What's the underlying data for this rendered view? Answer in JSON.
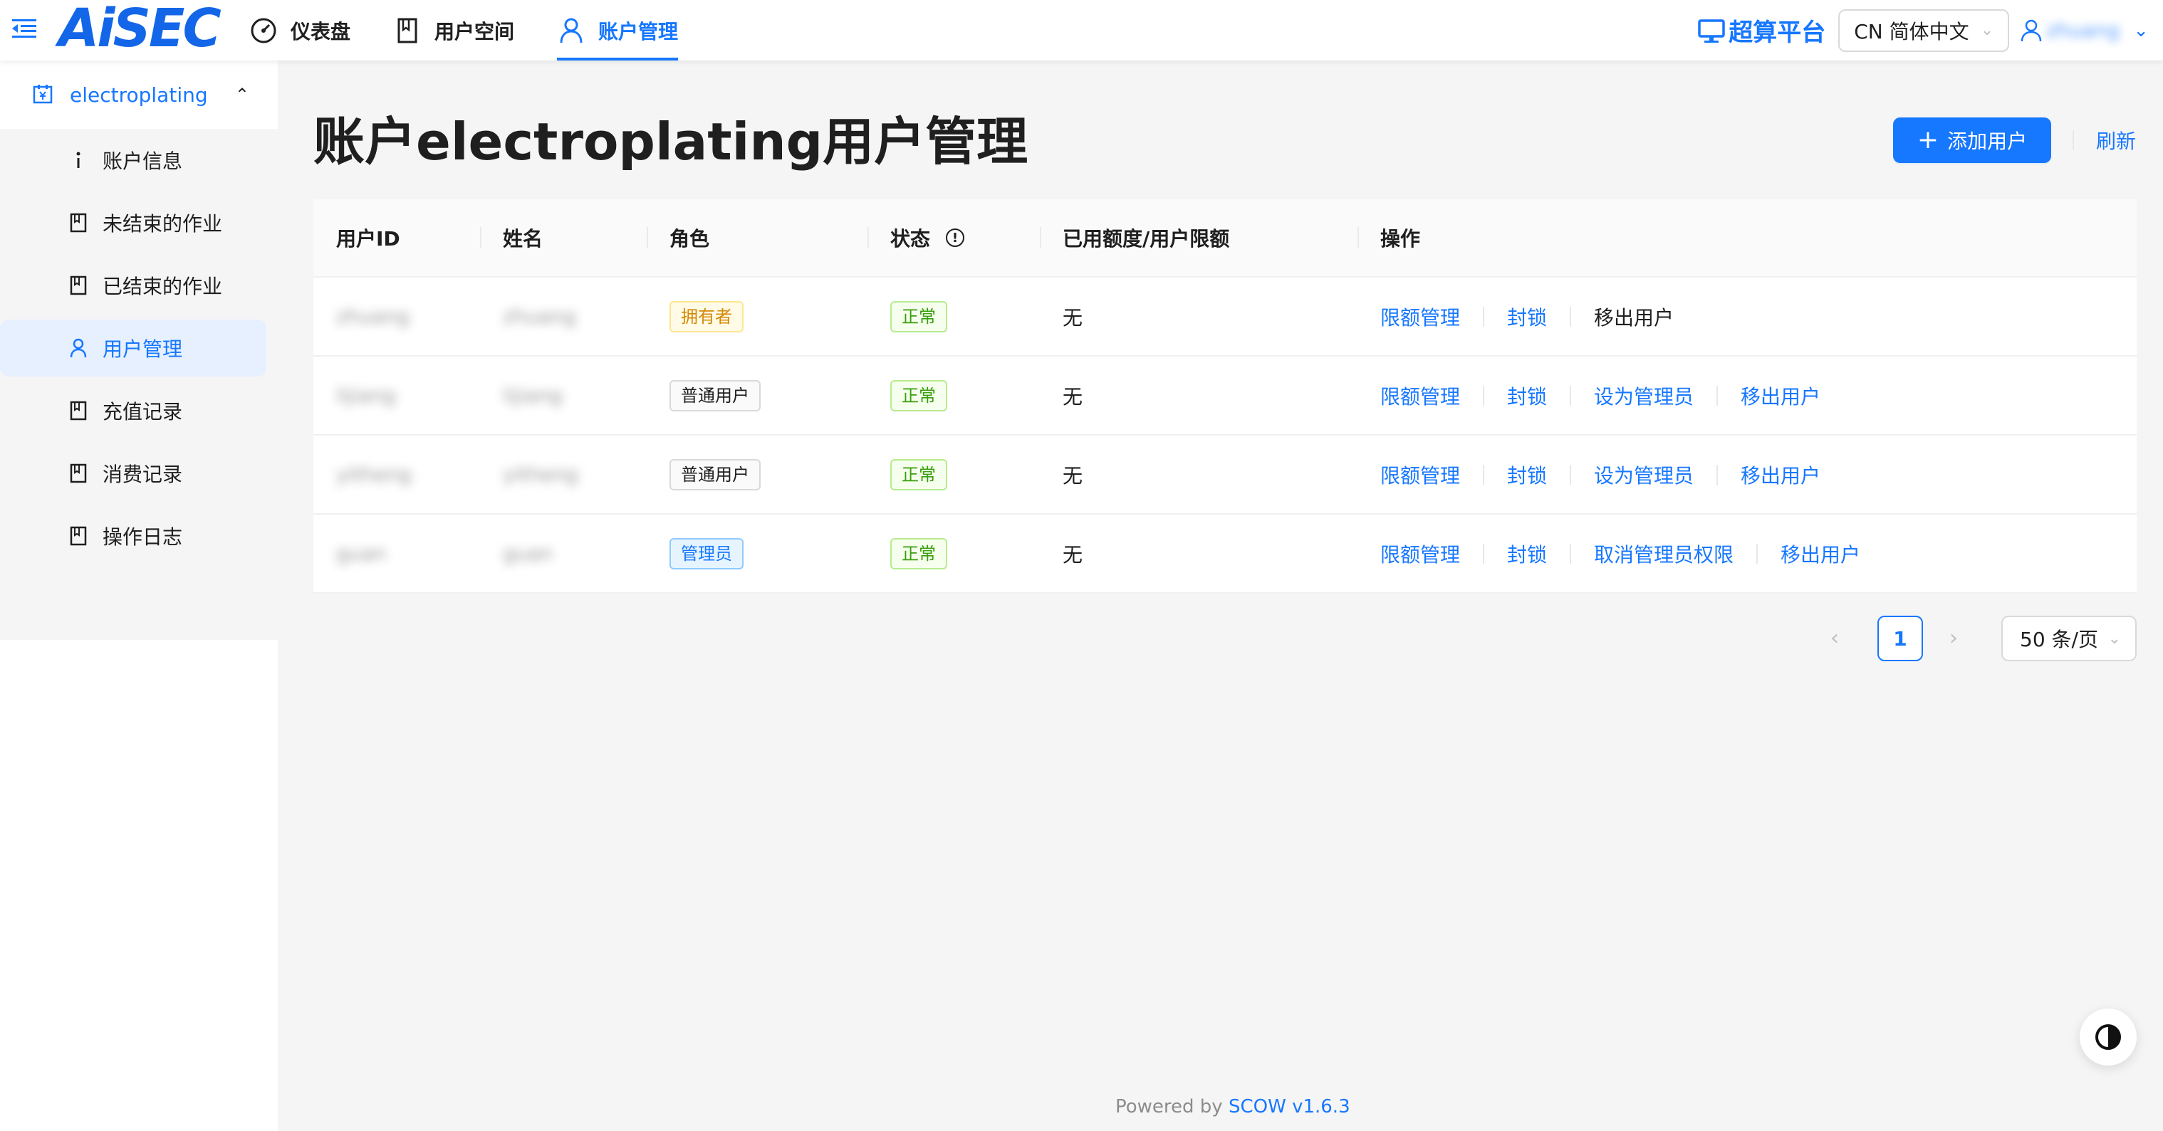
{
  "header": {
    "logo_text": "AiSEC",
    "nav": [
      {
        "label": "仪表盘",
        "icon": "dashboard-icon"
      },
      {
        "label": "用户空间",
        "icon": "book-icon"
      },
      {
        "label": "账户管理",
        "icon": "user-icon",
        "active": true
      }
    ],
    "platform_label": "超算平台",
    "lang_select": "CN 简体中文",
    "username": "zhuang"
  },
  "sidebar": {
    "group_label": "electroplating",
    "items": [
      {
        "label": "账户信息",
        "icon": "info-icon"
      },
      {
        "label": "未结束的作业",
        "icon": "book-icon"
      },
      {
        "label": "已结束的作业",
        "icon": "book-icon"
      },
      {
        "label": "用户管理",
        "icon": "user-icon",
        "active": true
      },
      {
        "label": "充值记录",
        "icon": "book-icon"
      },
      {
        "label": "消费记录",
        "icon": "book-icon"
      },
      {
        "label": "操作日志",
        "icon": "book-icon"
      }
    ]
  },
  "main": {
    "title": "账户electroplating用户管理",
    "add_button": "添加用户",
    "refresh": "刷新",
    "columns": [
      "用户ID",
      "姓名",
      "角色",
      "状态",
      "已用额度/用户限额",
      "操作"
    ],
    "rows": [
      {
        "id": "zhuang",
        "name": "zhuang",
        "role": "拥有者",
        "status": "正常",
        "quota": "无",
        "actions": [
          "限额管理",
          "封锁",
          "移出用户"
        ]
      },
      {
        "id": "lijiang",
        "name": "lijiang",
        "role": "普通用户",
        "status": "正常",
        "quota": "无",
        "actions": [
          "限额管理",
          "封锁",
          "设为管理员",
          "移出用户"
        ]
      },
      {
        "id": "yitheng",
        "name": "yitheng",
        "role": "普通用户",
        "status": "正常",
        "quota": "无",
        "actions": [
          "限额管理",
          "封锁",
          "设为管理员",
          "移出用户"
        ]
      },
      {
        "id": "guan",
        "name": "guan",
        "role": "管理员",
        "status": "正常",
        "quota": "无",
        "actions": [
          "限额管理",
          "封锁",
          "取消管理员权限",
          "移出用户"
        ]
      }
    ],
    "pagination": {
      "current": "1",
      "page_size": "50 条/页"
    }
  },
  "footer": {
    "prefix": "Powered by",
    "brand": "SCOW v1.6.3"
  },
  "colors": {
    "accent": "#1677ff",
    "owner": "#d48806",
    "ok": "#389e0d"
  }
}
